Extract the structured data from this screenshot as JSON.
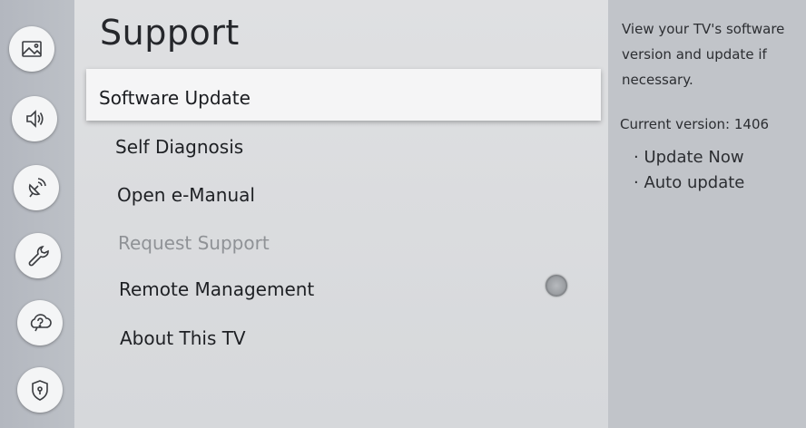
{
  "sidebar": {
    "icons": [
      "picture-icon",
      "sound-icon",
      "broadcasting-icon",
      "general-icon",
      "support-icon",
      "privacy-icon"
    ]
  },
  "panel": {
    "title": "Support",
    "items": [
      {
        "label": "Software Update",
        "state": "selected"
      },
      {
        "label": "Self Diagnosis",
        "state": "enabled"
      },
      {
        "label": "Open e-Manual",
        "state": "enabled"
      },
      {
        "label": "Request Support",
        "state": "disabled"
      },
      {
        "label": "Remote Management",
        "state": "enabled",
        "toggle": "off"
      },
      {
        "label": "About This TV",
        "state": "enabled"
      }
    ]
  },
  "info": {
    "description": "View your TV's software version and update if necessary.",
    "current_version": "Current version: 1406",
    "options": [
      "· Update Now",
      "· Auto update"
    ]
  }
}
